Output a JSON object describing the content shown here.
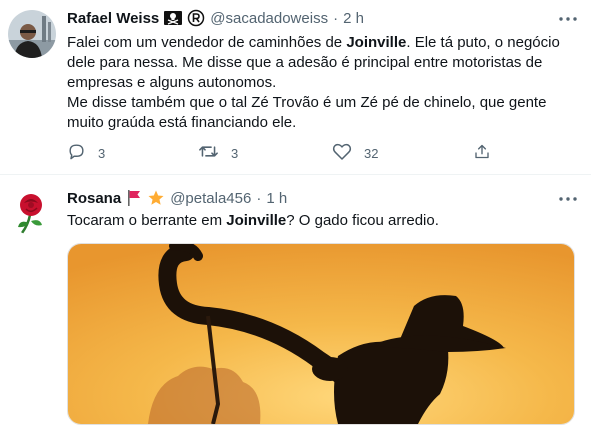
{
  "tweets": [
    {
      "name": "Rafael Weiss",
      "handle": "@sacadadoweiss",
      "time": "2 h",
      "text_lines": [
        {
          "before": "Falei com um vendedor de caminhões de ",
          "bold": "Joinville",
          "after": ". Ele tá puto, o negócio"
        },
        {
          "before": "dele para nessa. Me disse que a adesão é principal entre motoristas de",
          "bold": "",
          "after": ""
        },
        {
          "before": "empresas e alguns autonomos.",
          "bold": "",
          "after": ""
        },
        {
          "before": "Me disse também que o tal Zé Trovão é um Zé pé de chinelo, que gente",
          "bold": "",
          "after": ""
        },
        {
          "before": "muito graúda está financiando ele.",
          "bold": "",
          "after": ""
        }
      ],
      "replies": "3",
      "retweets": "3",
      "likes": "32"
    },
    {
      "name": "Rosana",
      "handle": "@petala456",
      "time": "1 h",
      "text_before": "Tocaram o berrante em ",
      "text_bold": "Joinville",
      "text_after": "? O gado ficou arredio."
    }
  ],
  "icons": {
    "badges_rafael": [
      "pirate-flag-icon",
      "registered-icon"
    ],
    "badges_rosana": [
      "red-flag-icon",
      "star-icon"
    ],
    "actions": [
      "reply-icon",
      "retweet-icon",
      "like-icon",
      "share-icon"
    ],
    "more": "more-options-icon"
  },
  "colors": {
    "text": "#0f1419",
    "secondary": "#536471",
    "divider": "#eff3f4",
    "sunset": "#f4b345"
  }
}
